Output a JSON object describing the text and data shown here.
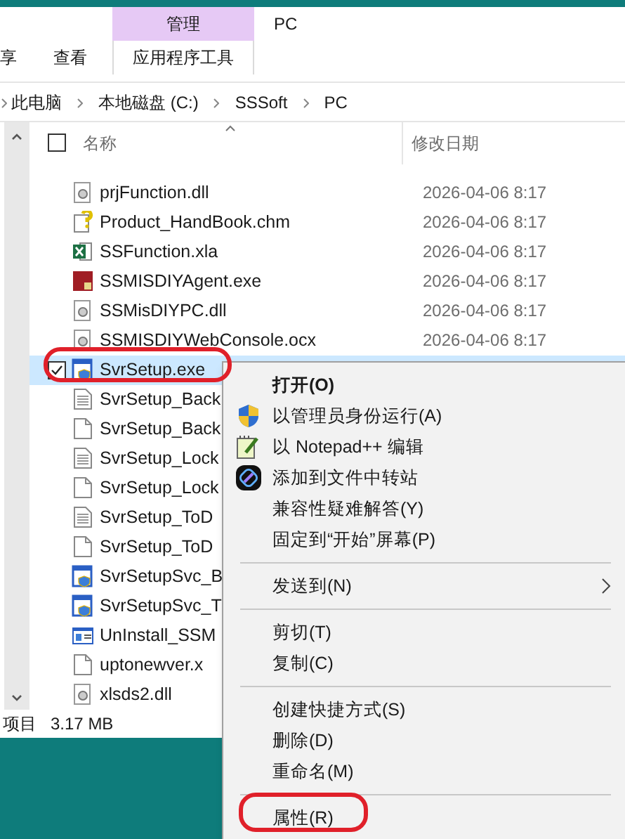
{
  "ribbon": {
    "context_group": "管理",
    "window_title": "PC",
    "tabs": [
      {
        "label": "享",
        "selected": false
      },
      {
        "label": "查看",
        "selected": false
      },
      {
        "label": "应用程序工具",
        "selected": true
      }
    ]
  },
  "breadcrumb": [
    "此电脑",
    "本地磁盘 (C:)",
    "SSSoft",
    "PC"
  ],
  "columns": {
    "name": "名称",
    "modified": "修改日期"
  },
  "header_checkbox": {
    "checked": false
  },
  "files": [
    {
      "name": "prjFunction.dll",
      "kind": "dll",
      "date": "2026-04-06 8:17",
      "selected": false
    },
    {
      "name": "Product_HandBook.chm",
      "kind": "chm",
      "date": "2026-04-06 8:17",
      "selected": false
    },
    {
      "name": "SSFunction.xla",
      "kind": "xla",
      "date": "2026-04-06 8:17",
      "selected": false
    },
    {
      "name": "SSMISDIYAgent.exe",
      "kind": "app",
      "date": "2026-04-06 8:17",
      "selected": false
    },
    {
      "name": "SSMisDIYPC.dll",
      "kind": "dll",
      "date": "2026-04-06 8:17",
      "selected": false
    },
    {
      "name": "SSMISDIYWebConsole.ocx",
      "kind": "dll",
      "date": "2026-04-06 8:17",
      "selected": false
    },
    {
      "name": "SvrSetup.exe",
      "kind": "setup",
      "selected": true
    },
    {
      "name": "SvrSetup_Back",
      "kind": "text",
      "selected": false
    },
    {
      "name": "SvrSetup_Back",
      "kind": "blank",
      "selected": false
    },
    {
      "name": "SvrSetup_Lock",
      "kind": "text",
      "selected": false
    },
    {
      "name": "SvrSetup_Lock",
      "kind": "blank",
      "selected": false
    },
    {
      "name": "SvrSetup_ToD",
      "kind": "text",
      "selected": false
    },
    {
      "name": "SvrSetup_ToD",
      "kind": "blank",
      "selected": false
    },
    {
      "name": "SvrSetupSvc_B",
      "kind": "setup",
      "selected": false
    },
    {
      "name": "SvrSetupSvc_T",
      "kind": "setup",
      "selected": false
    },
    {
      "name": "UnInstall_SSM",
      "kind": "window",
      "selected": false
    },
    {
      "name": "uptonewver.x",
      "kind": "blank",
      "selected": false
    },
    {
      "name": "xlsds2.dll",
      "kind": "dll",
      "selected": false
    }
  ],
  "status_bar": {
    "items": "项目",
    "size": "3.17 MB"
  },
  "context_menu": [
    {
      "kind": "item",
      "label": "打开(O)",
      "bold": true
    },
    {
      "kind": "item",
      "label": "以管理员身份运行(A)"
    },
    {
      "kind": "item",
      "label": "以 Notepad++ 编辑"
    },
    {
      "kind": "item",
      "label": "添加到文件中转站"
    },
    {
      "kind": "item",
      "label": "兼容性疑难解答(Y)"
    },
    {
      "kind": "item",
      "label": "固定到“开始”屏幕(P)"
    },
    {
      "kind": "separator"
    },
    {
      "kind": "submenu",
      "label": "发送到(N)"
    },
    {
      "kind": "separator"
    },
    {
      "kind": "item",
      "label": "剪切(T)"
    },
    {
      "kind": "item",
      "label": "复制(C)"
    },
    {
      "kind": "separator"
    },
    {
      "kind": "item",
      "label": "创建快捷方式(S)"
    },
    {
      "kind": "item",
      "label": "删除(D)"
    },
    {
      "kind": "item",
      "label": "重命名(M)"
    },
    {
      "kind": "separator"
    },
    {
      "kind": "item",
      "label": "属性(R)",
      "highlighted": true
    }
  ]
}
